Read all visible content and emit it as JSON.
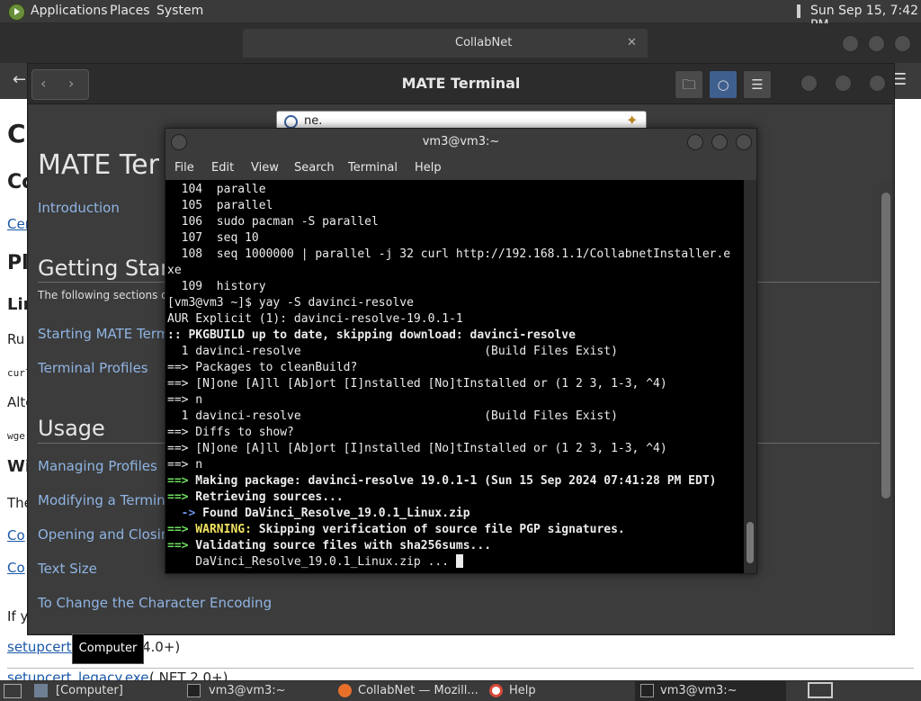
{
  "top_panel": {
    "menus": [
      "Applications",
      "Places",
      "System"
    ],
    "clock": "Sun Sep 15, 7:42 PM"
  },
  "browser": {
    "active_tab_title": "CollabNet",
    "tab_close": "✕",
    "back": "←",
    "menu": "☰",
    "content": {
      "h1": "C",
      "h2": "Co",
      "link1": "Cen",
      "h2b": "Pl",
      "h3a": "Lin",
      "p1": "Ru",
      "mono1": "curl",
      "p2": "Alte",
      "mono2": "wge",
      "h3b": "Wi",
      "p3": "The",
      "link2": "Co",
      "link3": "Co",
      "p4": "If y",
      "link4": "setupcert.",
      "link4_suffix": "4.0+)",
      "link5": "setupcert_legacy.exe",
      "link5_suffix": "(.NET 2.0+)",
      "right_fragment": "s"
    }
  },
  "help_window": {
    "title": "MATE Terminal",
    "search_text": "ne.",
    "page_title": "MATE Ter",
    "intro_link": "Introduction",
    "section1": "Getting Star",
    "section1_text": "The following sections de",
    "links1": [
      "Starting MATE Term",
      "Terminal Profiles"
    ],
    "section2": "Usage",
    "links2": [
      "Managing Profiles",
      "Modifying a Termina",
      "Opening and Closing",
      "Text Size",
      "To Change the Character Encoding"
    ]
  },
  "terminal": {
    "title": "vm3@vm3:~",
    "menu": [
      "File",
      "Edit",
      "View",
      "Search",
      "Terminal",
      "Help"
    ],
    "lines": [
      {
        "text": "  104  paralle",
        "style": ""
      },
      {
        "text": "  105  parallel",
        "style": ""
      },
      {
        "text": "  106  sudo pacman -S parallel",
        "style": ""
      },
      {
        "text": "  107  seq 10",
        "style": ""
      },
      {
        "text": "  108  seq 1000000 | parallel -j 32 curl http://192.168.1.1/CollabnetInstaller.e",
        "style": ""
      },
      {
        "text": "xe",
        "style": ""
      },
      {
        "text": "  109  history",
        "style": ""
      },
      {
        "text": "[vm3@vm3 ~]$ yay -S davinci-resolve",
        "style": ""
      },
      {
        "text": "AUR Explicit (1): davinci-resolve-19.0.1-1",
        "style": ""
      },
      {
        "text": ":: PKGBUILD up to date, skipping download: davinci-resolve",
        "style": "b"
      },
      {
        "text": "  1 davinci-resolve                          (Build Files Exist)",
        "style": ""
      },
      {
        "text": "==> Packages to cleanBuild?",
        "style": ""
      },
      {
        "text": "==> [N]one [A]ll [Ab]ort [I]nstalled [No]tInstalled or (1 2 3, 1-3, ^4)",
        "style": ""
      },
      {
        "text": "==> n",
        "style": ""
      },
      {
        "text": "  1 davinci-resolve                          (Build Files Exist)",
        "style": ""
      },
      {
        "text": "==> Diffs to show?",
        "style": ""
      },
      {
        "text": "==> [N]one [A]ll [Ab]ort [I]nstalled [No]tInstalled or (1 2 3, 1-3, ^4)",
        "style": ""
      },
      {
        "text": "==> n",
        "style": ""
      }
    ],
    "colored": {
      "l1_arrow": "==>",
      "l1_text": " Making package: davinci-resolve 19.0.1-1 (Sun 15 Sep 2024 07:41:28 PM EDT)",
      "l2_arrow": "==>",
      "l2_text": " Retrieving sources...",
      "l3_arrow": "  ->",
      "l3_text": " Found DaVinci_Resolve_19.0.1_Linux.zip",
      "l4_arrow": "==>",
      "l4_warn": " WARNING:",
      "l4_text": " Skipping verification of source file PGP signatures.",
      "l5_arrow": "==>",
      "l5_text": " Validating source files with sha256sums...",
      "l6_text": "    DaVinci_Resolve_19.0.1_Linux.zip ... "
    }
  },
  "tooltip": "Computer",
  "taskbar": {
    "items": [
      "[Computer]",
      "vm3@vm3:~",
      "CollabNet — Mozill...",
      "Help",
      "vm3@vm3:~"
    ]
  }
}
